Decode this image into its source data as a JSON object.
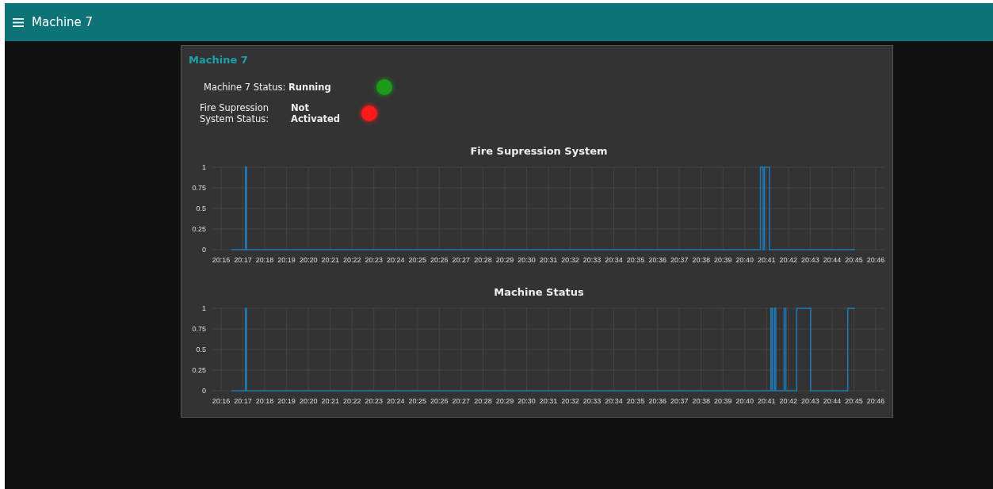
{
  "header": {
    "title": "Machine 7"
  },
  "card": {
    "title": "Machine 7",
    "statuses": [
      {
        "kind": "inline",
        "label": "Machine 7 Status:",
        "value": "Running",
        "color": "#1a9c1a"
      },
      {
        "kind": "stacked",
        "label": "Fire Supression System Status:",
        "value": "Not Activated",
        "color": "#ff1a1a"
      }
    ],
    "charts": [
      {
        "chart_data": {
          "type": "line",
          "title": "Fire Supression System",
          "grid": true,
          "xlim": [
            1215.6,
            1246.4
          ],
          "ylim": [
            0,
            1
          ],
          "yticks": [
            0,
            0.25,
            0.5,
            0.75,
            1
          ],
          "xticks": [
            {
              "value": 1216,
              "label": "20:16"
            },
            {
              "value": 1217,
              "label": "20:17"
            },
            {
              "value": 1218,
              "label": "20:18"
            },
            {
              "value": 1219,
              "label": "20:19"
            },
            {
              "value": 1220,
              "label": "20:20"
            },
            {
              "value": 1221,
              "label": "20:21"
            },
            {
              "value": 1222,
              "label": "20:22"
            },
            {
              "value": 1223,
              "label": "20:23"
            },
            {
              "value": 1224,
              "label": "20:24"
            },
            {
              "value": 1225,
              "label": "20:25"
            },
            {
              "value": 1226,
              "label": "20:26"
            },
            {
              "value": 1227,
              "label": "20:27"
            },
            {
              "value": 1228,
              "label": "20:28"
            },
            {
              "value": 1229,
              "label": "20:29"
            },
            {
              "value": 1230,
              "label": "20:30"
            },
            {
              "value": 1231,
              "label": "20:31"
            },
            {
              "value": 1232,
              "label": "20:32"
            },
            {
              "value": 1233,
              "label": "20:33"
            },
            {
              "value": 1234,
              "label": "20:34"
            },
            {
              "value": 1235,
              "label": "20:35"
            },
            {
              "value": 1236,
              "label": "20:36"
            },
            {
              "value": 1237,
              "label": "20:37"
            },
            {
              "value": 1238,
              "label": "20:38"
            },
            {
              "value": 1239,
              "label": "20:39"
            },
            {
              "value": 1240,
              "label": "20:40"
            },
            {
              "value": 1241,
              "label": "20:41"
            },
            {
              "value": 1242,
              "label": "20:42"
            },
            {
              "value": 1243,
              "label": "20:43"
            },
            {
              "value": 1244,
              "label": "20:44"
            },
            {
              "value": 1245,
              "label": "20:45"
            },
            {
              "value": 1246,
              "label": "20:46"
            }
          ],
          "x": [
            1216.46,
            1217.12,
            1217.12,
            1217.16,
            1217.16,
            1240.72,
            1240.72,
            1240.84,
            1240.84,
            1240.9,
            1240.9,
            1241.13,
            1241.13,
            1245.05
          ],
          "series": [
            {
              "color": "#1f77b4",
              "values": [
                0,
                0,
                1,
                1,
                0,
                0,
                1,
                1,
                0,
                0,
                1,
                1,
                0,
                0
              ]
            }
          ]
        }
      },
      {
        "chart_data": {
          "type": "line",
          "title": "Machine Status",
          "grid": true,
          "xlim": [
            1215.6,
            1246.4
          ],
          "ylim": [
            0,
            1
          ],
          "yticks": [
            0,
            0.25,
            0.5,
            0.75,
            1
          ],
          "xticks": [
            {
              "value": 1216,
              "label": "20:16"
            },
            {
              "value": 1217,
              "label": "20:17"
            },
            {
              "value": 1218,
              "label": "20:18"
            },
            {
              "value": 1219,
              "label": "20:19"
            },
            {
              "value": 1220,
              "label": "20:20"
            },
            {
              "value": 1221,
              "label": "20:21"
            },
            {
              "value": 1222,
              "label": "20:22"
            },
            {
              "value": 1223,
              "label": "20:23"
            },
            {
              "value": 1224,
              "label": "20:24"
            },
            {
              "value": 1225,
              "label": "20:25"
            },
            {
              "value": 1226,
              "label": "20:26"
            },
            {
              "value": 1227,
              "label": "20:27"
            },
            {
              "value": 1228,
              "label": "20:28"
            },
            {
              "value": 1229,
              "label": "20:29"
            },
            {
              "value": 1230,
              "label": "20:30"
            },
            {
              "value": 1231,
              "label": "20:31"
            },
            {
              "value": 1232,
              "label": "20:32"
            },
            {
              "value": 1233,
              "label": "20:33"
            },
            {
              "value": 1234,
              "label": "20:34"
            },
            {
              "value": 1235,
              "label": "20:35"
            },
            {
              "value": 1236,
              "label": "20:36"
            },
            {
              "value": 1237,
              "label": "20:37"
            },
            {
              "value": 1238,
              "label": "20:38"
            },
            {
              "value": 1239,
              "label": "20:39"
            },
            {
              "value": 1240,
              "label": "20:40"
            },
            {
              "value": 1241,
              "label": "20:41"
            },
            {
              "value": 1242,
              "label": "20:42"
            },
            {
              "value": 1243,
              "label": "20:43"
            },
            {
              "value": 1244,
              "label": "20:44"
            },
            {
              "value": 1245,
              "label": "20:45"
            },
            {
              "value": 1246,
              "label": "20:46"
            }
          ],
          "x": [
            1216.46,
            1217.12,
            1217.12,
            1217.16,
            1217.16,
            1241.2,
            1241.2,
            1241.26,
            1241.26,
            1241.36,
            1241.36,
            1241.42,
            1241.42,
            1241.8,
            1241.8,
            1241.88,
            1241.88,
            1242.38,
            1242.38,
            1243.02,
            1243.02,
            1244.72,
            1244.72,
            1245.05
          ],
          "series": [
            {
              "color": "#1f77b4",
              "values": [
                0,
                0,
                1,
                1,
                0,
                0,
                1,
                1,
                0,
                0,
                1,
                1,
                0,
                0,
                1,
                1,
                0,
                0,
                1,
                1,
                0,
                0,
                1,
                1
              ]
            }
          ]
        }
      }
    ]
  }
}
